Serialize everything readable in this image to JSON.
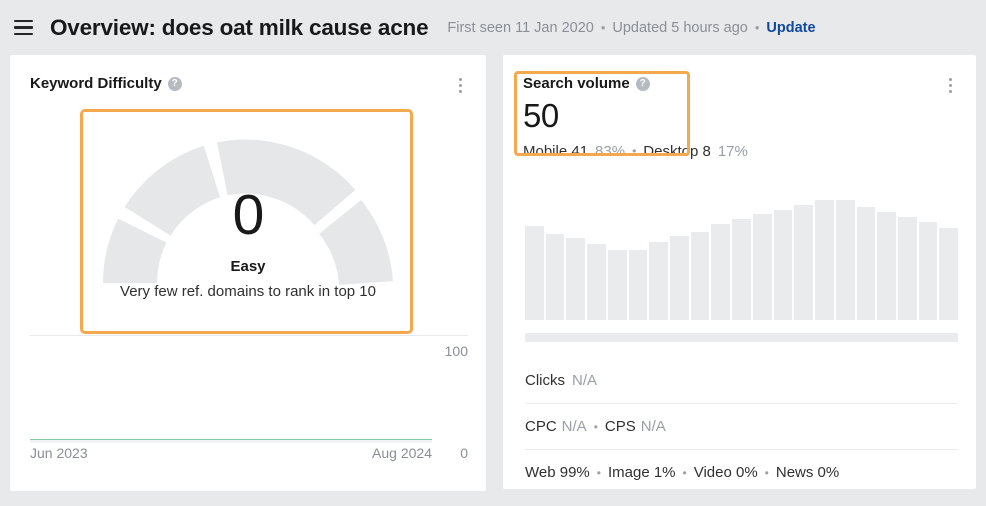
{
  "header": {
    "menu_icon": "hamburger-icon",
    "title": "Overview: does oat milk cause acne",
    "first_seen": "First seen 11 Jan 2020",
    "updated": "Updated 5 hours ago",
    "separator": "•",
    "update_label": "Update",
    "link_color": "#10489b"
  },
  "keyword_difficulty": {
    "title": "Keyword Difficulty",
    "help_icon": "question-mark-icon",
    "kebab_icon": "more-options-icon",
    "value": "0",
    "label": "Easy",
    "description": "Very few ref. domains to rank in top 10",
    "highlight_color": "#f5a94e",
    "gauge_track_color": "#e8e9eb",
    "trend": {
      "max_label": "100",
      "min_label": "0",
      "x_start": "Jun 2023",
      "x_end": "Aug 2024",
      "line_color": "#0d9258"
    }
  },
  "search_volume": {
    "title": "Search volume",
    "help_icon": "question-mark-icon",
    "kebab_icon": "more-options-icon",
    "value": "50",
    "highlight_color": "#f5a94e",
    "mobile_label": "Mobile 41",
    "mobile_pct": "83%",
    "desktop_label": "Desktop 8",
    "desktop_pct": "17%",
    "separator": "•",
    "clicks_label": "Clicks",
    "clicks_value": "N/A",
    "cpc_label": "CPC",
    "cpc_value": "N/A",
    "cps_label": "CPS",
    "cps_value": "N/A",
    "web_label": "Web 99%",
    "image_label": "Image 1%",
    "video_label": "Video 0%",
    "news_label": "News 0%"
  },
  "chart_data": [
    {
      "type": "bar",
      "title": "Search volume history",
      "xlabel": "",
      "ylabel": "",
      "bar_color": "#eaebec",
      "categories": [
        "1",
        "2",
        "3",
        "4",
        "5",
        "6",
        "7",
        "8",
        "9",
        "10",
        "11",
        "12",
        "13",
        "14",
        "15",
        "16",
        "17",
        "18",
        "19",
        "20",
        "21"
      ],
      "values": [
        78,
        72,
        68,
        63,
        58,
        58,
        65,
        70,
        73,
        80,
        84,
        88,
        92,
        96,
        100,
        100,
        94,
        90,
        86,
        82,
        77
      ],
      "ylim": [
        0,
        100
      ],
      "grid": false,
      "legend": "none"
    },
    {
      "type": "line",
      "title": "Keyword Difficulty over time",
      "xlabel": "",
      "ylabel": "",
      "x": [
        "Jun 2023",
        "Aug 2024"
      ],
      "series": [
        {
          "name": "Keyword Difficulty",
          "values": [
            0,
            0,
            0,
            0,
            0,
            0,
            0,
            0,
            0,
            0,
            0
          ]
        }
      ],
      "ylim": [
        0,
        100
      ],
      "line_color": "#0d9258",
      "grid": false,
      "legend": "none"
    }
  ]
}
